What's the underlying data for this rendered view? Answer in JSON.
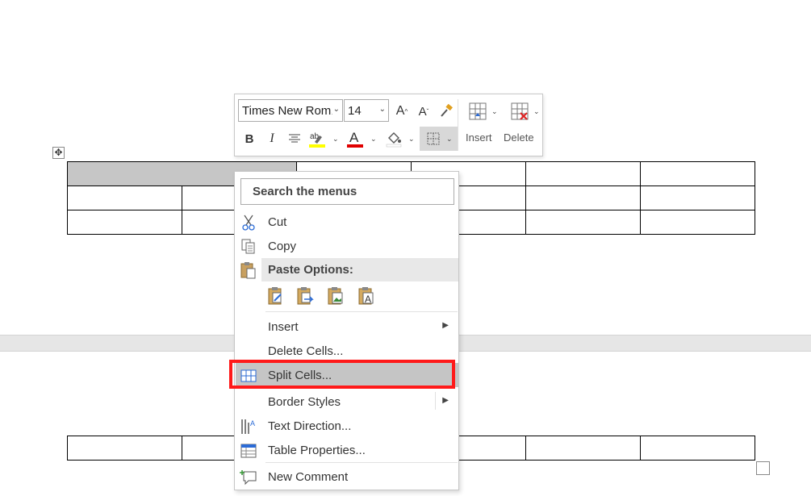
{
  "toolbar": {
    "font_name": "Times New Roman",
    "font_size": "14",
    "insert_label": "Insert",
    "delete_label": "Delete",
    "highlight_color": "#ffff00",
    "font_color": "#e00000"
  },
  "context_menu": {
    "search_placeholder": "Search the menus",
    "paste_options_label": "Paste Options:",
    "items": [
      {
        "label": "Cut",
        "icon": "scissors-icon"
      },
      {
        "label": "Copy",
        "icon": "copy-icon"
      },
      {
        "label": "Insert",
        "icon": "",
        "submenu": true
      },
      {
        "label": "Delete Cells...",
        "icon": ""
      },
      {
        "label": "Split Cells...",
        "icon": "split-cells-icon"
      },
      {
        "label": "Border Styles",
        "icon": "",
        "submenu": true
      },
      {
        "label": "Text Direction...",
        "icon": "text-direction-icon"
      },
      {
        "label": "Table Properties...",
        "icon": "table-properties-icon"
      },
      {
        "label": "New Comment",
        "icon": "new-comment-icon"
      }
    ],
    "paste_options": [
      "keep-source-formatting-icon",
      "merge-table-icon",
      "picture-icon",
      "keep-text-only-icon"
    ]
  },
  "colors": {
    "selection": "#c6c6c6",
    "menu_highlight": "#c5c5c5",
    "annotation_box": "#ff1a1a"
  }
}
